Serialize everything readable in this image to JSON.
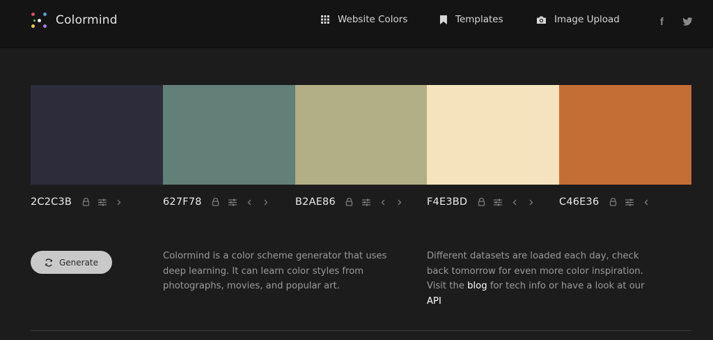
{
  "app": {
    "title": "Colormind",
    "logo_dot_colors": [
      "#d44d5c",
      "#5a9bd5",
      "#f1c84b",
      "#7ac26f",
      "#b57ad6",
      "#e8e8e8"
    ]
  },
  "nav": {
    "items": [
      {
        "label": "Website Colors",
        "icon": "grid-icon"
      },
      {
        "label": "Templates",
        "icon": "bookmark-icon"
      },
      {
        "label": "Image Upload",
        "icon": "camera-icon"
      }
    ],
    "social": [
      {
        "icon": "facebook-icon",
        "text": "f"
      },
      {
        "icon": "twitter-icon"
      }
    ]
  },
  "palette": {
    "swatches": [
      {
        "hex": "2C2C3B",
        "color": "#2c2c3b",
        "arrows": [
          "right"
        ]
      },
      {
        "hex": "627F78",
        "color": "#627f78",
        "arrows": [
          "left",
          "right"
        ]
      },
      {
        "hex": "B2AE86",
        "color": "#b2ae86",
        "arrows": [
          "left",
          "right"
        ]
      },
      {
        "hex": "F4E3BD",
        "color": "#f4e3bd",
        "arrows": [
          "left",
          "right"
        ]
      },
      {
        "hex": "C46E36",
        "color": "#c46e36",
        "arrows": [
          "left"
        ]
      }
    ]
  },
  "generate": {
    "label": "Generate",
    "icon": "refresh-icon"
  },
  "description": {
    "left": "Colormind is a color scheme generator that uses deep learning. It can learn color styles from photographs, movies, and popular art.",
    "right_prefix": "Different datasets are loaded each day, check back tomorrow for even more color inspiration. Visit the",
    "right_link1": "blog",
    "right_middle": "for tech info or have a look at our",
    "right_link2": "API"
  }
}
